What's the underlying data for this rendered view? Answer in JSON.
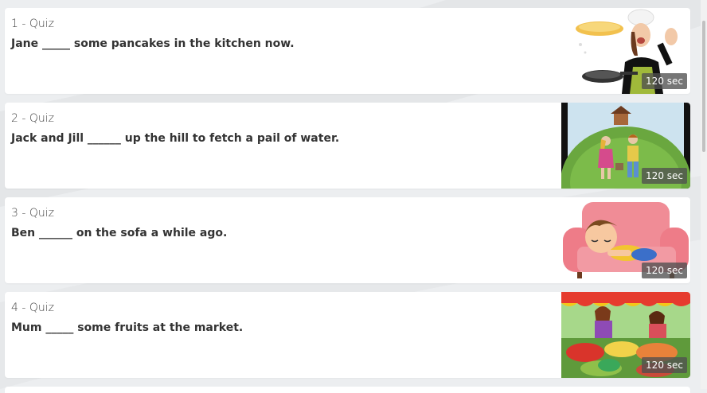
{
  "quizzes": [
    {
      "number_label": "1 - Quiz",
      "question": "Jane _____ some pancakes in the kitchen now.",
      "timer": "120 sec",
      "image": "chef-flipping-pancake-image"
    },
    {
      "number_label": "2 - Quiz",
      "question": "Jack and Jill ______ up the hill to fetch a pail of water.",
      "timer": "120 sec",
      "image": "jack-and-jill-hill-image"
    },
    {
      "number_label": "3 - Quiz",
      "question": "Ben ______ on the sofa a while ago.",
      "timer": "120 sec",
      "image": "boy-sleeping-on-sofa-image"
    },
    {
      "number_label": "4 - Quiz",
      "question": "Mum _____ some fruits at the market.",
      "timer": "120 sec",
      "image": "fruit-market-image"
    }
  ],
  "colors": {
    "background": "#eceef0",
    "card": "#ffffff",
    "timer_badge": "#505050"
  }
}
